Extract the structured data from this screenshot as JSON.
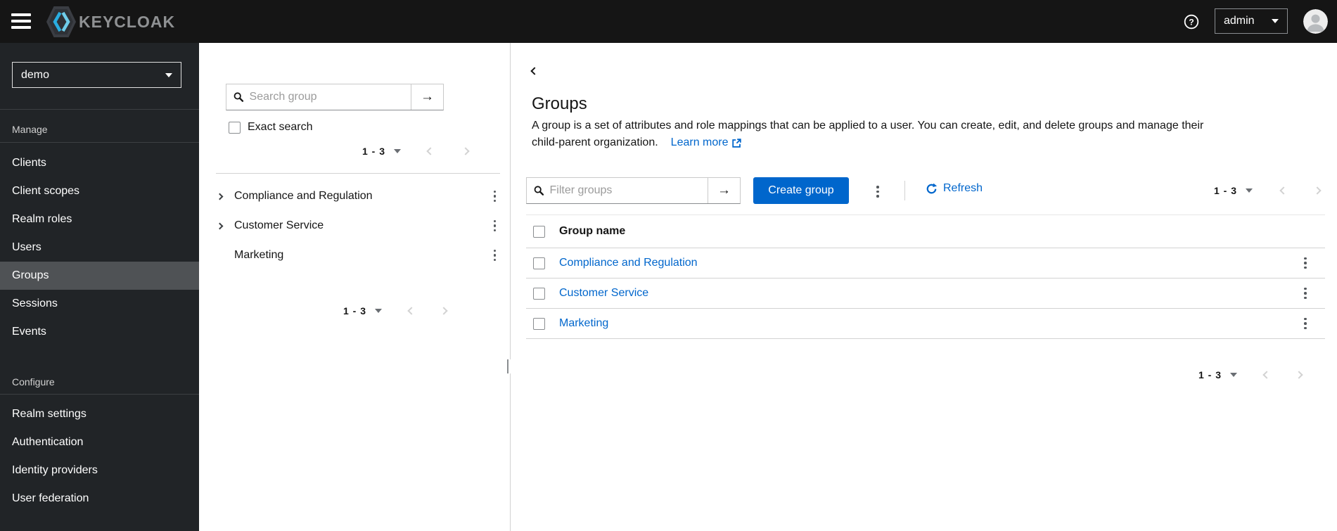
{
  "header": {
    "logo_text": "KEYCLOAK",
    "username": "admin"
  },
  "sidebar": {
    "realm_selector": {
      "value": "demo"
    },
    "sections": [
      {
        "label": "Manage",
        "items": [
          {
            "label": "Clients"
          },
          {
            "label": "Client scopes"
          },
          {
            "label": "Realm roles"
          },
          {
            "label": "Users"
          },
          {
            "label": "Groups"
          },
          {
            "label": "Sessions"
          },
          {
            "label": "Events"
          }
        ]
      },
      {
        "label": "Configure",
        "items": [
          {
            "label": "Realm settings"
          },
          {
            "label": "Authentication"
          },
          {
            "label": "Identity providers"
          },
          {
            "label": "User federation"
          }
        ]
      }
    ]
  },
  "tree_panel": {
    "search_placeholder": "Search group",
    "exact_search_label": "Exact search",
    "pagination_top": "1 - 3",
    "pagination_bottom": "1 - 3",
    "items": [
      {
        "label": "Compliance and Regulation",
        "expandable": true
      },
      {
        "label": "Customer Service",
        "expandable": true
      },
      {
        "label": "Marketing",
        "expandable": false
      }
    ]
  },
  "main": {
    "title": "Groups",
    "description_line1": "A group is a set of attributes and role mappings that can be applied to a user. You can create, edit, and delete groups and manage their",
    "description_line2": "child-parent organization.",
    "learn_more_label": "Learn more",
    "toolbar": {
      "filter_placeholder": "Filter groups",
      "create_button_label": "Create group",
      "refresh_label": "Refresh",
      "pagination": "1 - 3"
    },
    "table": {
      "columns": [
        "Group name"
      ],
      "rows": [
        {
          "name": "Compliance and Regulation"
        },
        {
          "name": "Customer Service"
        },
        {
          "name": "Marketing"
        }
      ]
    },
    "pagination_bottom": "1 - 3"
  },
  "colors": {
    "accent_blue": "#0066cc",
    "header_bg": "#151515",
    "sidebar_bg": "#212427",
    "sidebar_active_bg": "#4f5255",
    "link_blue": "#0066cc"
  }
}
